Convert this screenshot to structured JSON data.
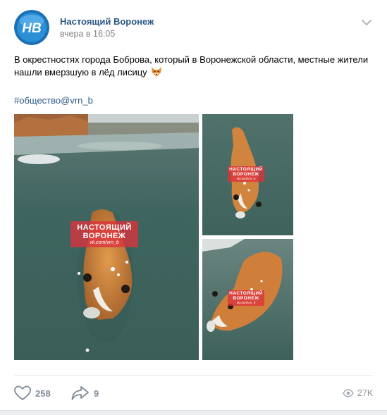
{
  "post": {
    "author": "Настоящий Воронеж",
    "avatar_text": "НВ",
    "time": "вчера в 16:05",
    "text": "В окрестностях города Боброва, который в Воронежской области, местные жители нашли вмерзшую в лёд лисицу",
    "emoji_icon": "fox-face-icon",
    "hashtag": "#общество@vrn_b"
  },
  "photos": {
    "watermark_line1": "НАСТОЯЩИЙ",
    "watermark_line2": "ВОРОНЕЖ",
    "watermark_sub": "vk.com/vrn_b"
  },
  "actions": {
    "likes": "258",
    "shares": "9",
    "views": "27K"
  },
  "colors": {
    "link": "#2a5885",
    "muted": "#818c99",
    "avatar_bg": "#2b8fd6",
    "watermark": "#dc323c"
  }
}
